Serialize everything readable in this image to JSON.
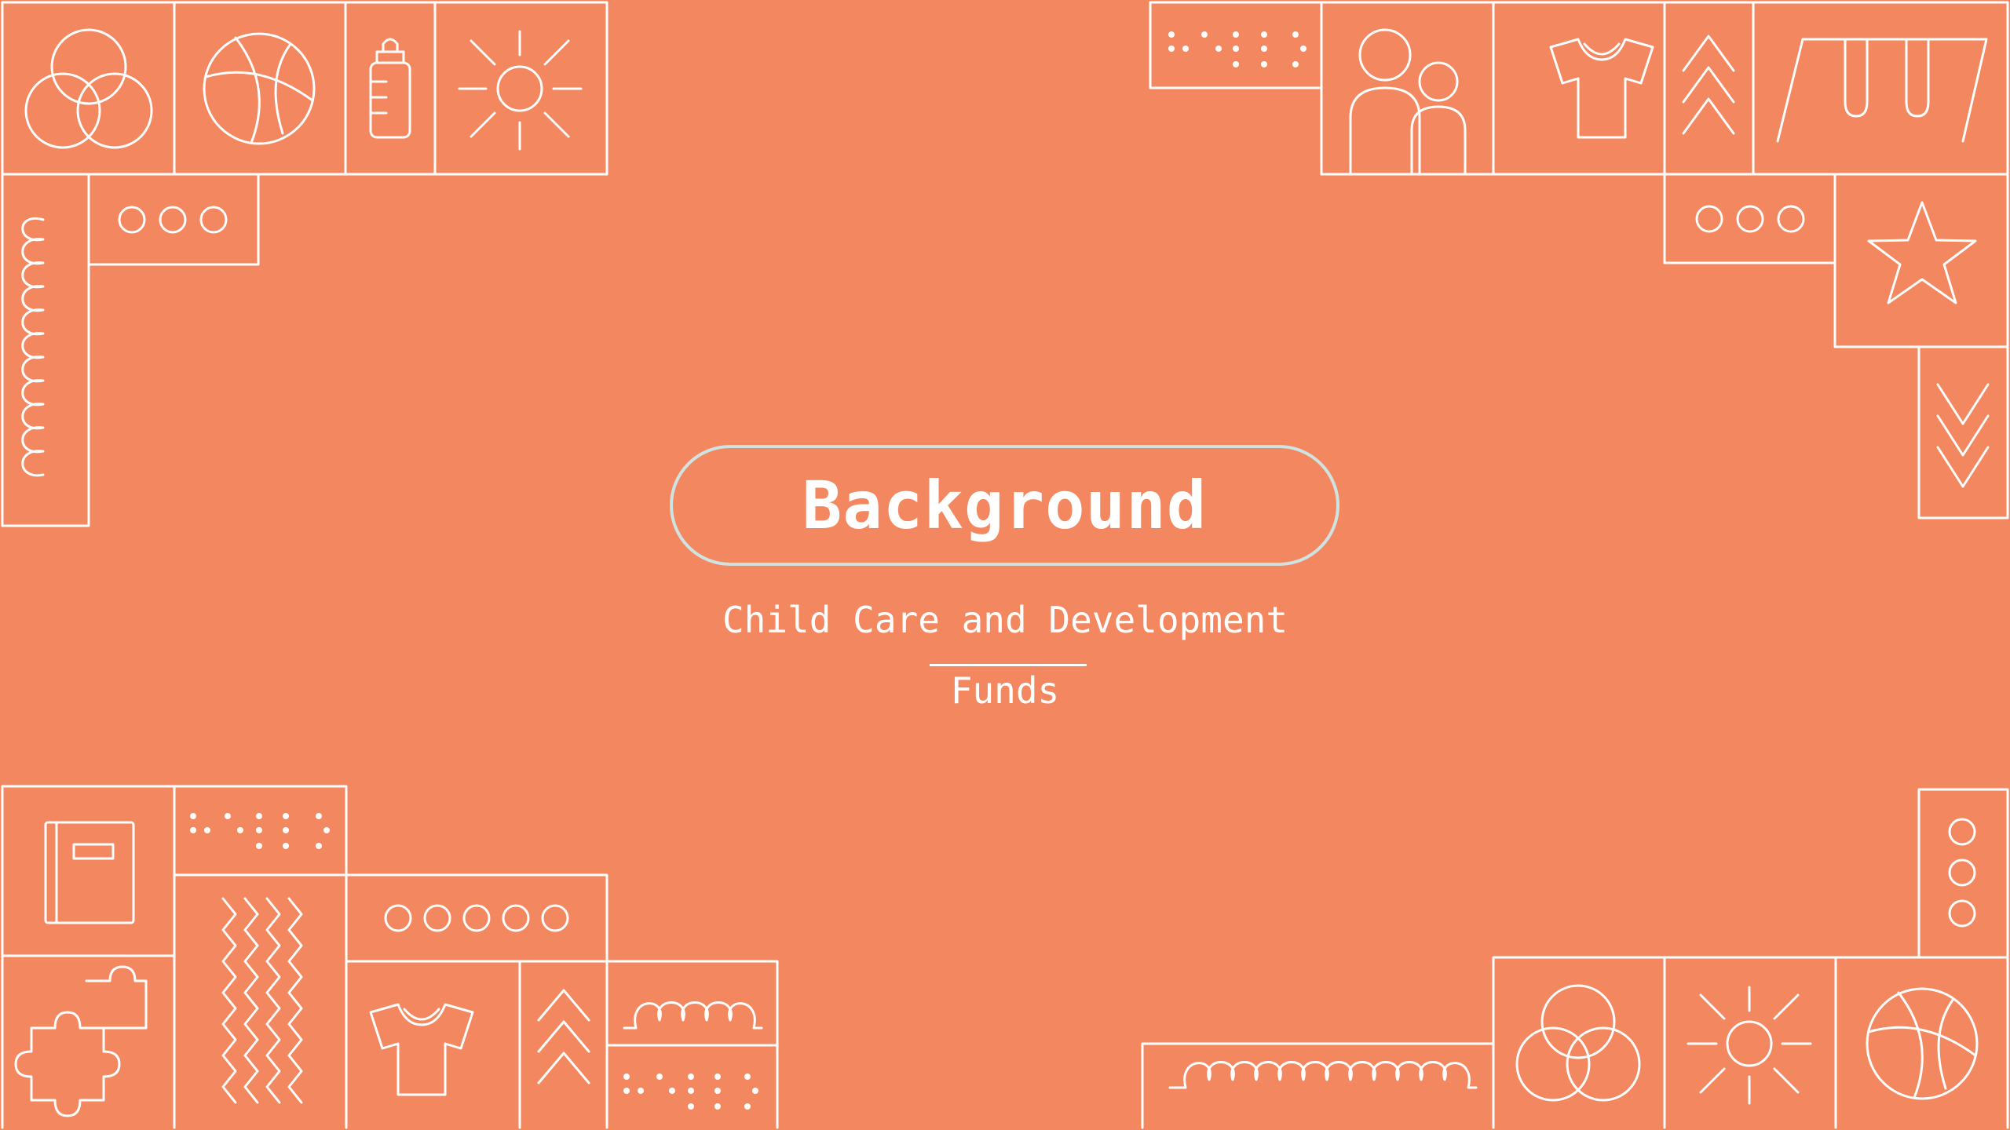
{
  "slide": {
    "title": "Background",
    "subtitle_line1": "Child Care and Development",
    "subtitle_line2": "Funds"
  },
  "colors": {
    "background": "#f3875f",
    "line": "#ffffff",
    "pill_border": "#cfe4e2"
  },
  "icons": [
    "venn-circles-icon",
    "ball-icon",
    "baby-bottle-icon",
    "sun-icon",
    "dots-pattern-icon",
    "people-icon",
    "shirt-icon",
    "chevron-up-icon",
    "swing-set-icon",
    "circles-row-icon",
    "star-icon",
    "chevron-down-icon",
    "loops-icon",
    "book-icon",
    "puzzle-icon",
    "zigzag-icon"
  ]
}
